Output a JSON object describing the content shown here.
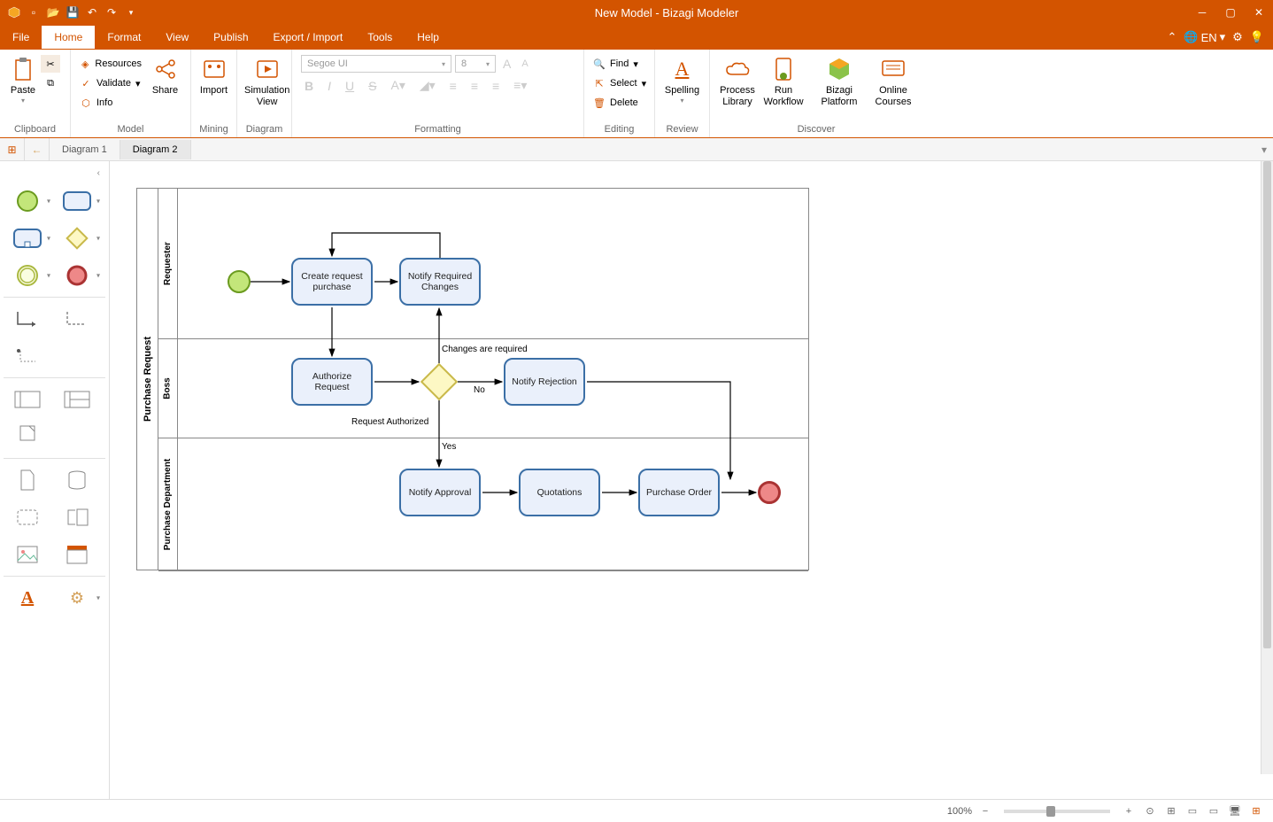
{
  "window": {
    "title": "New Model - Bizagi Modeler"
  },
  "menu": {
    "file": "File",
    "items": [
      "Home",
      "Format",
      "View",
      "Publish",
      "Export / Import",
      "Tools",
      "Help"
    ],
    "active": "Home",
    "lang": "EN"
  },
  "ribbon": {
    "clipboard": {
      "label": "Clipboard",
      "paste": "Paste"
    },
    "model": {
      "label": "Model",
      "resources": "Resources",
      "validate": "Validate",
      "info": "Info",
      "share": "Share"
    },
    "mining": {
      "label": "Mining",
      "import": "Import"
    },
    "diagram": {
      "label": "Diagram",
      "simview": "Simulation View"
    },
    "formatting": {
      "label": "Formatting",
      "font": "Segoe UI",
      "size": "8"
    },
    "editing": {
      "label": "Editing",
      "find": "Find",
      "select": "Select",
      "delete": "Delete"
    },
    "review": {
      "label": "Review",
      "spelling": "Spelling"
    },
    "discover": {
      "label": "Discover",
      "plib": "Process Library",
      "runwf": "Run Workflow",
      "platform": "Bizagi Platform",
      "courses": "Online Courses"
    }
  },
  "tabs": {
    "items": [
      "Diagram 1",
      "Diagram 2"
    ],
    "active": "Diagram 2"
  },
  "diagram": {
    "pool": "Purchase Request",
    "lanes": [
      "Requester",
      "Boss",
      "Purchase Department"
    ],
    "tasks": {
      "create": "Create request purchase",
      "notify_changes": "Notify Required Changes",
      "authorize": "Authorize Request",
      "reject": "Notify Rejection",
      "approve": "Notify Approval",
      "quotations": "Quotations",
      "po": "Purchase Order"
    },
    "labels": {
      "changes_required": "Changes are required",
      "no": "No",
      "request_authorized": "Request Authorized",
      "yes": "Yes"
    }
  },
  "status": {
    "zoom": "100%"
  }
}
